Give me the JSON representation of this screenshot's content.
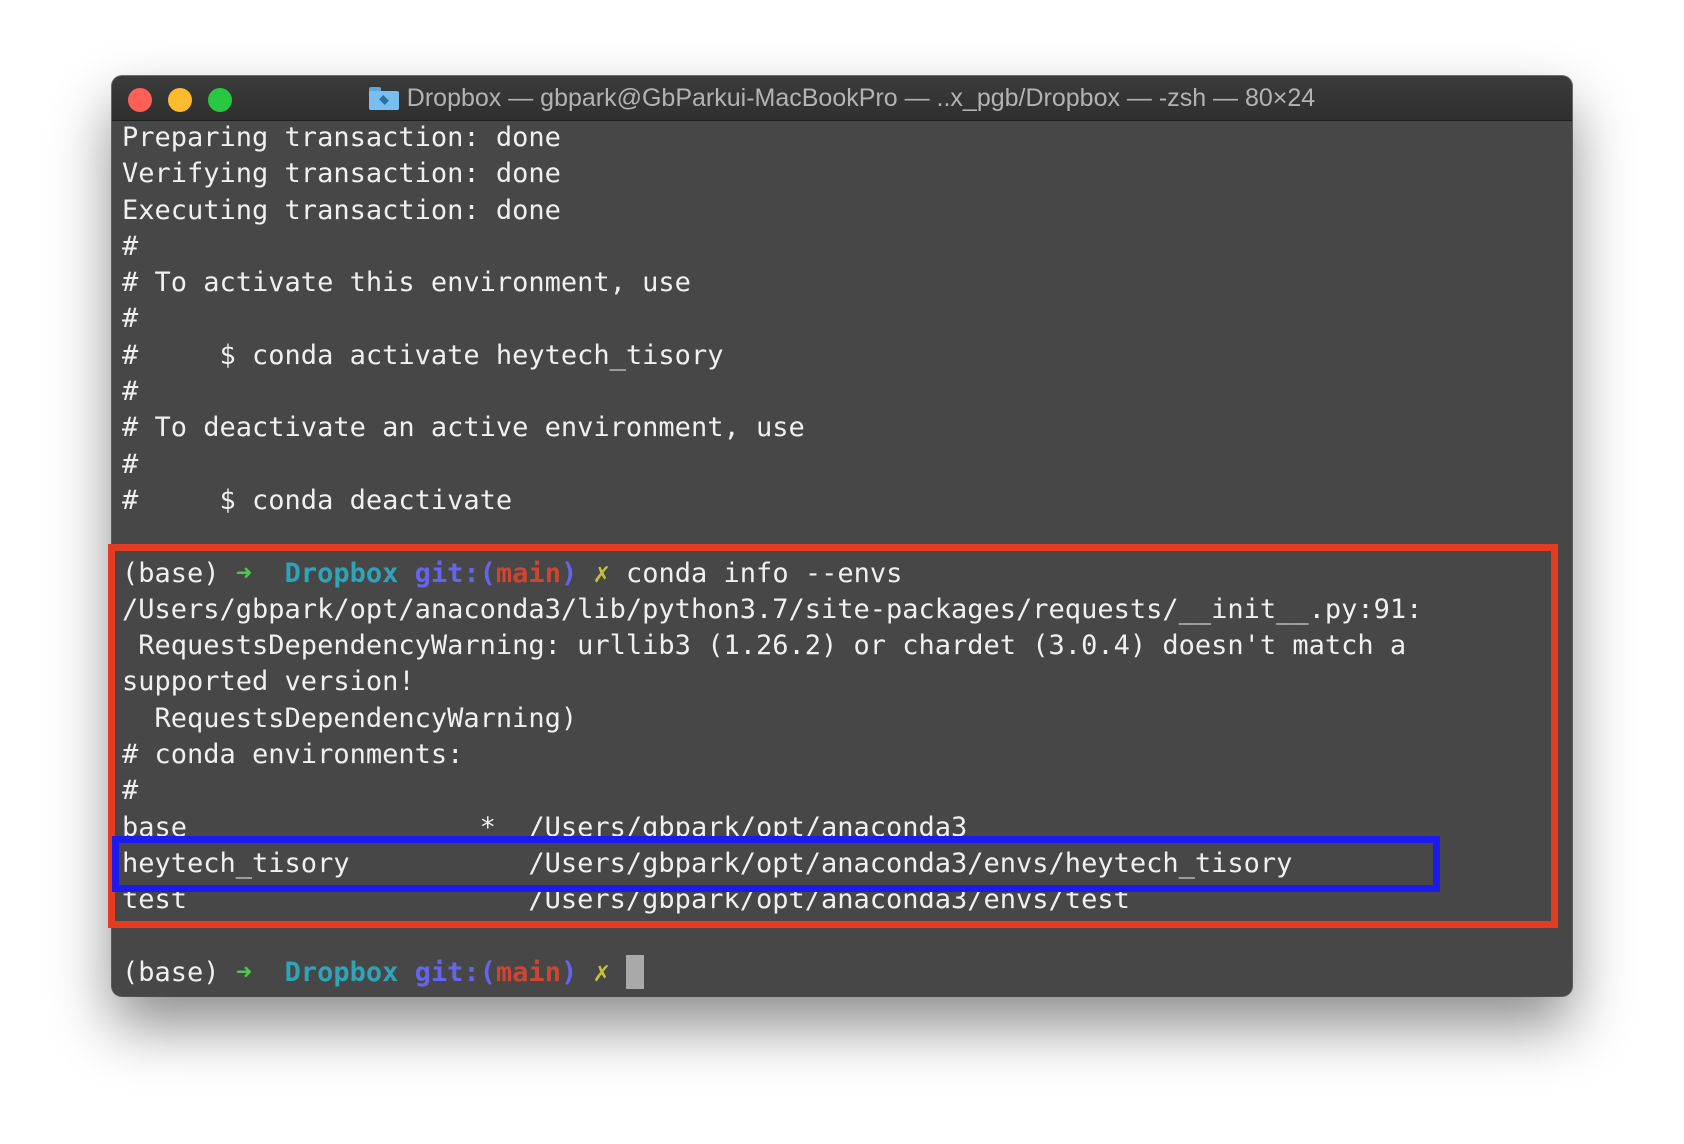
{
  "window": {
    "title": "Dropbox — gbpark@GbParkui-MacBookPro — ..x_pgb/Dropbox — -zsh — 80×24",
    "folder_icon": "dropbox-folder-icon"
  },
  "output_lines": [
    "Preparing transaction: done",
    "Verifying transaction: done",
    "Executing transaction: done",
    "#",
    "# To activate this environment, use",
    "#",
    "#     $ conda activate heytech_tisory",
    "#",
    "# To deactivate an active environment, use",
    "#",
    "#     $ conda deactivate",
    ""
  ],
  "prompt": {
    "env": "(base) ",
    "arrow": "➜",
    "dir": "Dropbox",
    "git_open": "git:(",
    "branch": "main",
    "git_close": ")",
    "dirty": "✗"
  },
  "command": "conda info --envs",
  "command_output": [
    "/Users/gbpark/opt/anaconda3/lib/python3.7/site-packages/requests/__init__.py:91:",
    " RequestsDependencyWarning: urllib3 (1.26.2) or chardet (3.0.4) doesn't match a",
    "supported version!",
    "  RequestsDependencyWarning)",
    "# conda environments:",
    "#",
    "base                  *  /Users/gbpark/opt/anaconda3",
    "heytech_tisory           /Users/gbpark/opt/anaconda3/envs/heytech_tisory",
    "test                     /Users/gbpark/opt/anaconda3/envs/test",
    ""
  ],
  "colors": {
    "highlight_red": "#e33c22",
    "highlight_blue": "#1b1bf0",
    "terminal_bg": "#474747"
  }
}
